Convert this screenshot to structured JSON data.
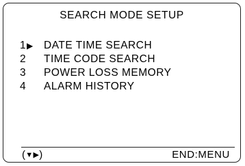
{
  "screen": {
    "title": "SEARCH MODE SETUP"
  },
  "menu": {
    "items": [
      {
        "number": "1",
        "label": "DATE TIME SEARCH",
        "selected": true
      },
      {
        "number": "2",
        "label": "TIME CODE SEARCH",
        "selected": false
      },
      {
        "number": "3",
        "label": "POWER LOSS MEMORY",
        "selected": false
      },
      {
        "number": "4",
        "label": "ALARM HISTORY",
        "selected": false
      }
    ],
    "cursor_icon": "triangle-right-icon"
  },
  "footer": {
    "nav_open": "(",
    "nav_down_icon": "triangle-down-icon",
    "nav_right_icon": "triangle-right-icon",
    "nav_close": ")",
    "end_label": "END:MENU"
  }
}
